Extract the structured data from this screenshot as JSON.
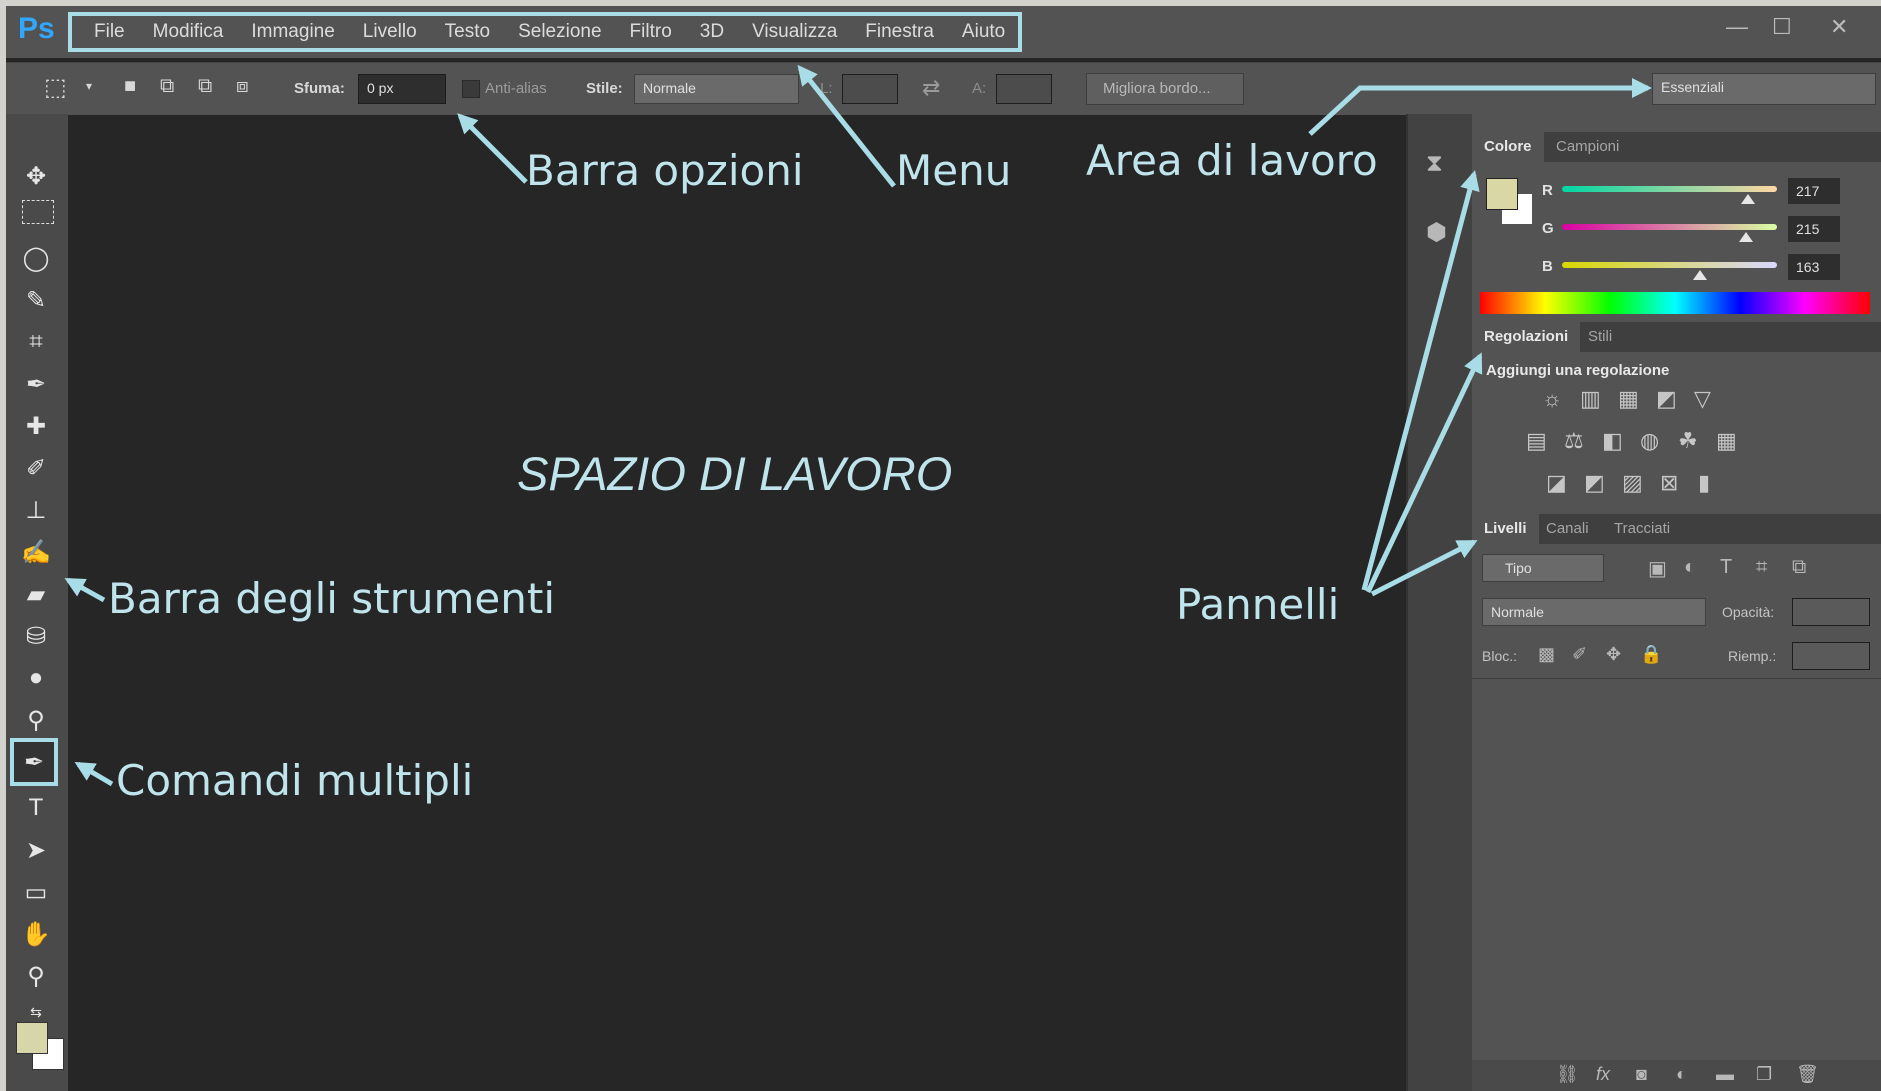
{
  "app": {
    "logo": "Ps",
    "minimize": "—",
    "maximize": "☐",
    "close": "✕"
  },
  "menu": {
    "items": [
      {
        "label": "File"
      },
      {
        "label": "Modifica"
      },
      {
        "label": "Immagine"
      },
      {
        "label": "Livello"
      },
      {
        "label": "Testo"
      },
      {
        "label": "Selezione"
      },
      {
        "label": "Filtro"
      },
      {
        "label": "3D"
      },
      {
        "label": "Visualizza"
      },
      {
        "label": "Finestra"
      },
      {
        "label": "Aiuto"
      }
    ]
  },
  "options": {
    "feather_label": "Sfuma:",
    "feather_value": "0 px",
    "antialias_label": "Anti-alias",
    "style_label": "Stile:",
    "style_value": "Normale",
    "width_label": "L:",
    "height_label": "A:",
    "refine_edge": "Migliora bordo...",
    "workspace": "Essenziali"
  },
  "annotations": {
    "menu": "Menu",
    "options_bar": "Barra opzioni",
    "workspace_area": "Area di lavoro",
    "canvas": "SPAZIO DI LAVORO",
    "toolbar": "Barra degli strumenti",
    "multi_commands": "Comandi multipli",
    "panels": "Pannelli"
  },
  "color_panel": {
    "tabs": [
      "Colore",
      "Campioni"
    ],
    "r_label": "R",
    "g_label": "G",
    "b_label": "B",
    "r": "217",
    "g": "215",
    "b": "163",
    "foreground": "#d9d7a3"
  },
  "adjustments_panel": {
    "tabs": [
      "Regolazioni",
      "Stili"
    ],
    "heading": "Aggiungi una regolazione"
  },
  "layers_panel": {
    "tabs": [
      "Livelli",
      "Canali",
      "Tracciati"
    ],
    "filter": "Tipo",
    "blend_mode": "Normale",
    "opacity_label": "Opacità:",
    "lock_label": "Bloc.:",
    "fill_label": "Riemp.:"
  },
  "colors": {
    "accent": "#a8dce6",
    "annotation_text": "#bfe4ec"
  }
}
